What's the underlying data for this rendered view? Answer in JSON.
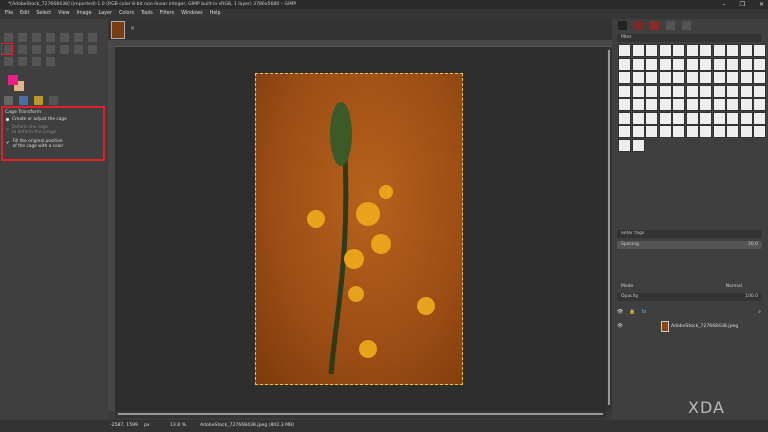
{
  "window": {
    "title": "*[AdobeStock_727668438] (imported)-1.0 (RGB color 8-bit non-linear integer, GIMP built-in sRGB, 1 layer) 3786x5680 – GIMP",
    "controls": [
      "–",
      "❐",
      "✕"
    ]
  },
  "menu": [
    "File",
    "Edit",
    "Select",
    "View",
    "Image",
    "Layer",
    "Colors",
    "Tools",
    "Filters",
    "Windows",
    "Help"
  ],
  "image_tab": {
    "close": "✕"
  },
  "tool_options": {
    "title": "Cage Transform",
    "options": [
      {
        "label": "Create or adjust the cage",
        "selected": true
      },
      {
        "label": "Deform the cage to deform the image",
        "line1": "Deform the cage",
        "line2": "to deform the image",
        "selected": false
      }
    ],
    "checkbox": {
      "line1": "Fill the original position",
      "line2": "of the cage with a color",
      "checked": true
    }
  },
  "colors": {
    "foreground": "#e8208a",
    "background": "#e0b48a",
    "highlight": "#e0202a"
  },
  "right_panel": {
    "filter_placeholder": "filter",
    "tags_placeholder": "enter tags",
    "spacing_label": "Spacing",
    "spacing_value": "20.0",
    "mode_label": "Mode",
    "mode_value": "Normal",
    "opacity_label": "Opacity",
    "opacity_value": "100.0",
    "layer_name": "AdobeStock_727668438.jpeg"
  },
  "status": {
    "coords": "-2587, 1599",
    "unit": "px",
    "zoom": "13.8 %",
    "file": "AdobeStock_727668438.jpeg (802.3 MB)"
  },
  "watermark": "XDA"
}
